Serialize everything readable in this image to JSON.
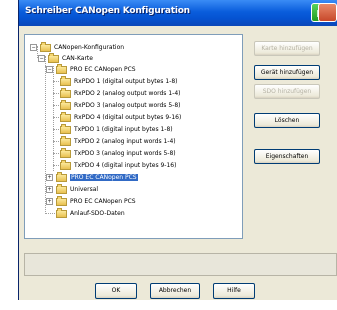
{
  "window": {
    "title": "Schreiber CANopen Konfiguration"
  },
  "tree": {
    "items": [
      {
        "label": "CANopen-Konfiguration",
        "expander": "−"
      },
      {
        "label": "CAN-Karte",
        "expander": "−"
      },
      {
        "label": "PRO EC CANopen PCS",
        "expander": "−"
      },
      {
        "label": "RxPDO 1 (digital output bytes 1-8)"
      },
      {
        "label": "RxPDO 2 (analog output words 1-4)"
      },
      {
        "label": "RxPDO 3 (analog output words 5-8)"
      },
      {
        "label": "RxPDO 4 (digital output bytes 9-16)"
      },
      {
        "label": "TxPDO 1 (digital input bytes 1-8)"
      },
      {
        "label": "TxPDO 2 (analog input words 1-4)"
      },
      {
        "label": "TxPDO 3 (analog input words 5-8)"
      },
      {
        "label": "TxPDO 4 (digital input bytes 9-16)"
      },
      {
        "label": "PRO EC CANopen PCS",
        "expander": "+",
        "selected": true
      },
      {
        "label": "Universal",
        "expander": "+"
      },
      {
        "label": "PRO EC CANopen PCS",
        "expander": "+"
      },
      {
        "label": "Anlauf-SDO-Daten"
      }
    ]
  },
  "side_buttons": {
    "add_card": "Karte hinzufügen",
    "add_device": "Gerät hinzufügen",
    "add_sdo": "SDO hinzufügen",
    "delete": "Löschen",
    "properties": "Eigenschaften"
  },
  "bottom_buttons": {
    "ok": "OK",
    "cancel": "Abbrechen",
    "help": "Hilfe"
  },
  "colors": {
    "titlebar": "#0a5ddc",
    "selection": "#316ac5",
    "dialog_bg": "#ece9d8"
  }
}
